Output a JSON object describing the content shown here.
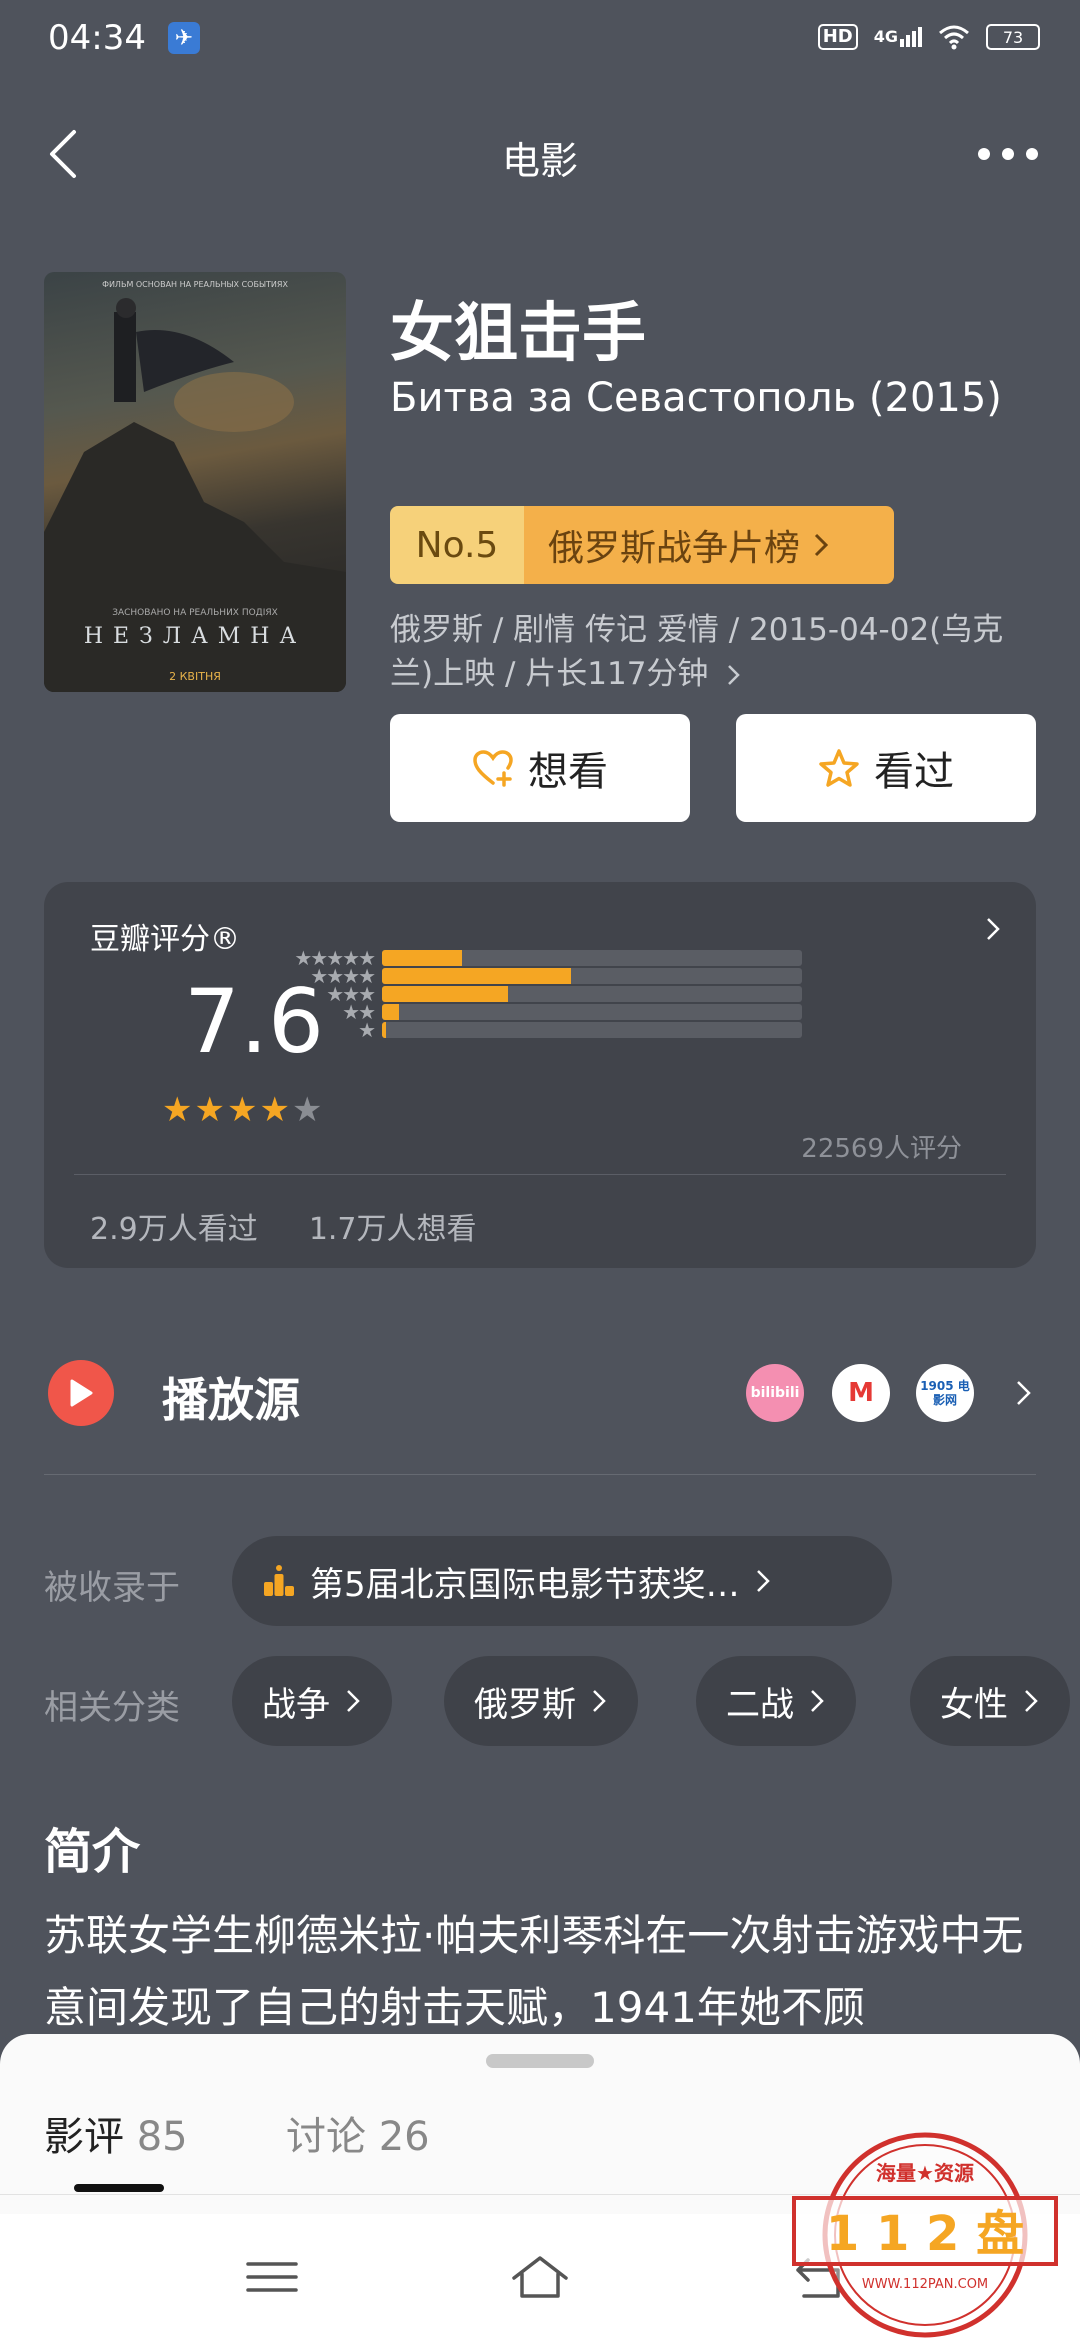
{
  "status": {
    "time": "04:34",
    "network": "4G",
    "hd": "HD",
    "battery": "73"
  },
  "header": {
    "title": "电影"
  },
  "poster": {
    "top_text": "ФИЛЬМ ОСНОВАН НА РЕАЛЬНЫХ СОБЫТИЯХ",
    "subtitle": "ЗАСНОВАНО НА РЕАЛЬНИХ ПОДІЯХ",
    "title": "НЕЗЛАМНА",
    "date": "2 КВІТНЯ"
  },
  "movie": {
    "title": "女狙击手",
    "original_title": "Битва за Севастополь (2015)",
    "rank_no": "No.5",
    "rank_list": "俄罗斯战争片榜",
    "meta": "俄罗斯 / 剧情 传记 爱情 / 2015-04-02(乌克兰)上映 / 片长117分钟"
  },
  "actions": {
    "want": "想看",
    "seen": "看过"
  },
  "rating": {
    "label": "豆瓣评分®",
    "score": "7.6",
    "stars": 4,
    "distribution": [
      {
        "stars": "★★★★★",
        "value": 0.19
      },
      {
        "stars": "★★★★",
        "value": 0.45
      },
      {
        "stars": "★★★",
        "value": 0.3
      },
      {
        "stars": "★★",
        "value": 0.04
      },
      {
        "stars": "★",
        "value": 0.01
      }
    ],
    "count": "22569人评分",
    "watched": "2.9万人看过",
    "wanted": "1.7万人想看"
  },
  "play_source": {
    "label": "播放源",
    "sources": [
      "bilibili",
      "M",
      "1905 电影网"
    ]
  },
  "collection": {
    "label": "被收录于",
    "award": "第5届北京国际电影节获奖…"
  },
  "categories": {
    "label": "相关分类",
    "tags": [
      "战争",
      "俄罗斯",
      "二战",
      "女性"
    ]
  },
  "intro": {
    "title": "简介",
    "text": "苏联女学生柳德米拉·帕夫利琴科在一次射击游戏中无意间发现了自己的射击天赋，1941年她不顾"
  },
  "sheet": {
    "reviews": "影评",
    "reviews_count": "85",
    "discussion": "讨论",
    "discussion_count": "26"
  },
  "watermark": {
    "top": "海量★资源",
    "main": "1 1 2 盘",
    "url": "WWW.112PAN.COM"
  },
  "colors": {
    "background": "#4f535c",
    "accent": "#f5a623",
    "play": "#f0564a"
  }
}
